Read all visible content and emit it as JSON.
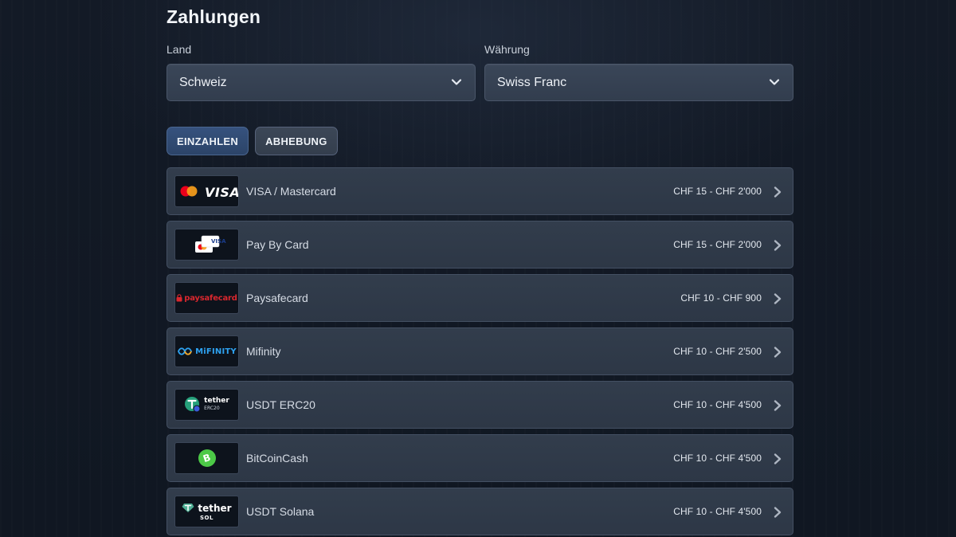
{
  "page": {
    "title": "Zahlungen"
  },
  "filters": {
    "country": {
      "label": "Land",
      "value": "Schweiz"
    },
    "currency": {
      "label": "Währung",
      "value": "Swiss Franc"
    }
  },
  "tabs": [
    {
      "label": "EINZAHLEN",
      "active": true
    },
    {
      "label": "ABHEBUNG",
      "active": false
    }
  ],
  "methods": [
    {
      "name": "VISA / Mastercard",
      "range": "CHF 15 - CHF 2'000",
      "logo": "visa-mastercard",
      "logo_text": "VISA"
    },
    {
      "name": "Pay By Card",
      "range": "CHF 15 - CHF 2'000",
      "logo": "pay-by-card",
      "logo_text": "VISA"
    },
    {
      "name": "Paysafecard",
      "range": "CHF 10 - CHF 900",
      "logo": "paysafecard",
      "logo_text": "paysafecard"
    },
    {
      "name": "Mifinity",
      "range": "CHF 10 - CHF 2'500",
      "logo": "mifinity",
      "logo_text": "MiFINITY"
    },
    {
      "name": "USDT ERC20",
      "range": "CHF 10 - CHF 4'500",
      "logo": "tether-erc20",
      "logo_text": "tether",
      "logo_sub": "ERC20"
    },
    {
      "name": "BitCoinCash",
      "range": "CHF 10 - CHF 4'500",
      "logo": "bitcoincash",
      "logo_text": "B"
    },
    {
      "name": "USDT Solana",
      "range": "CHF 10 - CHF 4'500",
      "logo": "tether-sol",
      "logo_text": "tether",
      "logo_sub": "SOL"
    }
  ],
  "colors": {
    "accent_tab": "#36527e",
    "mastercard_red": "#eb001b",
    "mastercard_orange": "#f79e1b",
    "tether_green": "#26a17b",
    "bch_green": "#4cc947",
    "paysafe_red": "#d9272e",
    "mifinity_blue": "#2ea3f2"
  }
}
